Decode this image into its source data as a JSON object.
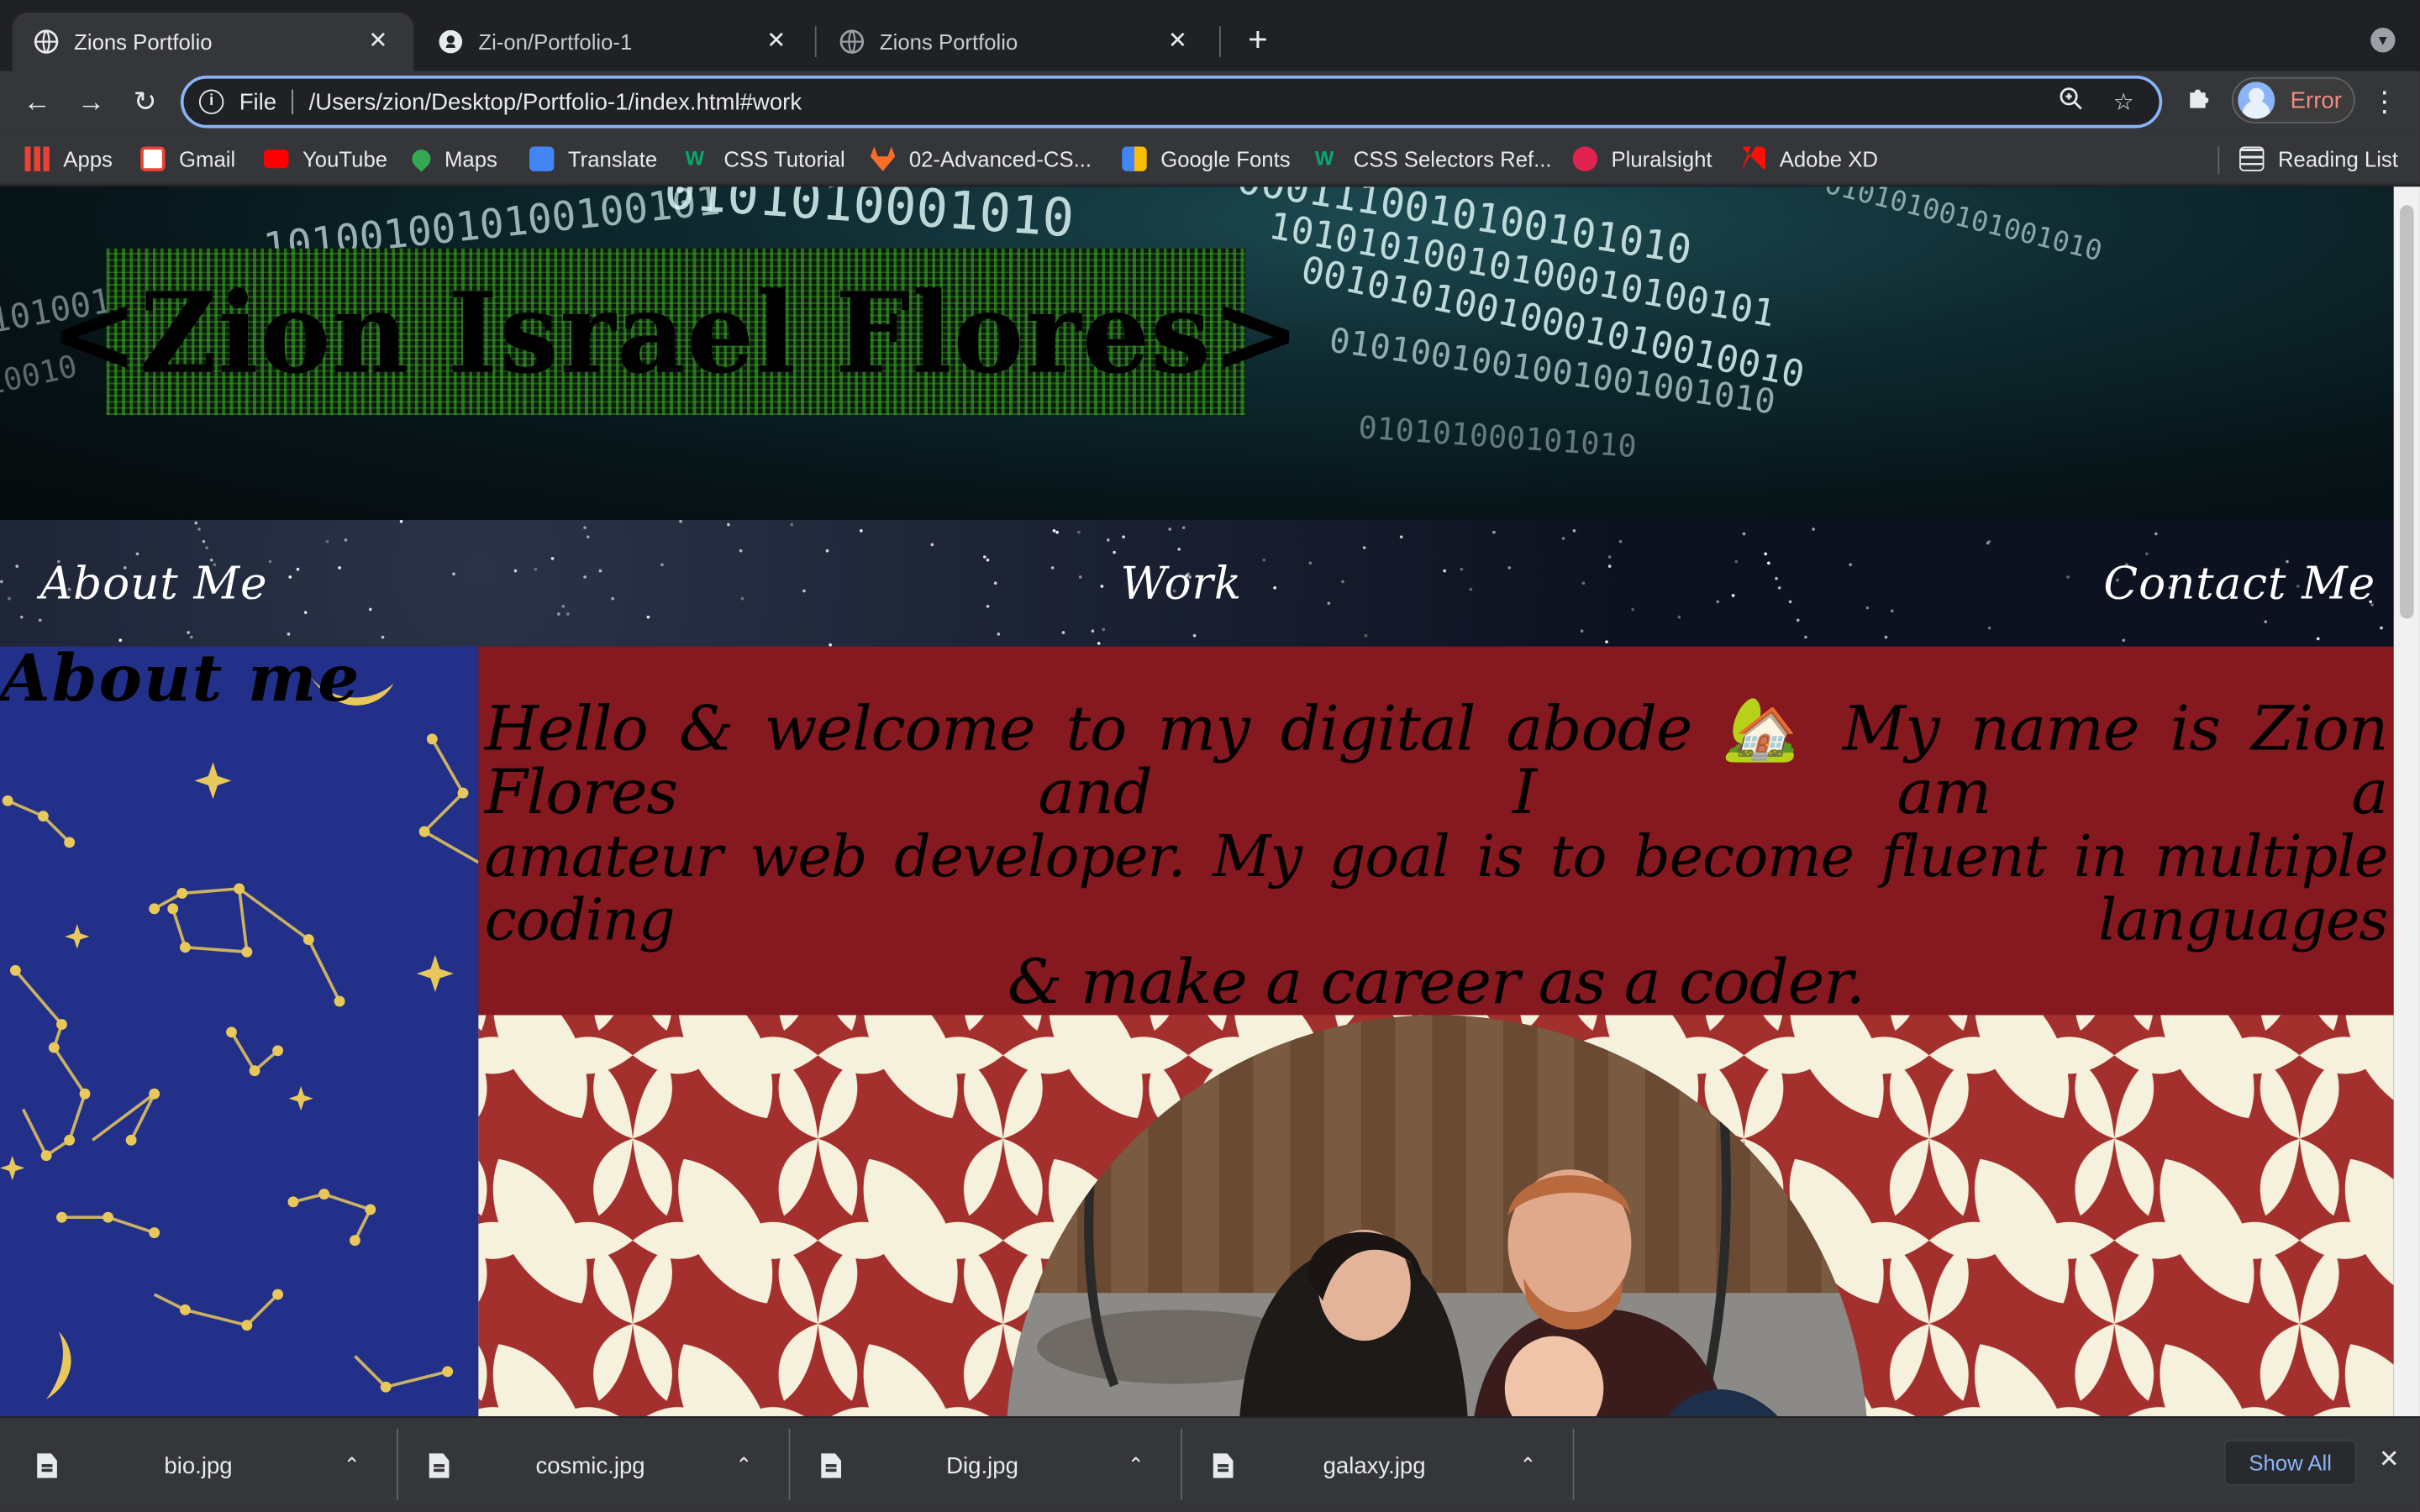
{
  "browser": {
    "tabs": [
      {
        "title": "Zions Portfolio",
        "active": true,
        "icon": "globe-icon"
      },
      {
        "title": "Zi-on/Portfolio-1",
        "active": false,
        "icon": "github-icon"
      },
      {
        "title": "Zions Portfolio",
        "active": false,
        "icon": "globe-icon"
      }
    ],
    "new_tab_label": "+",
    "address": {
      "scheme": "File",
      "url": "/Users/zion/Desktop/Portfolio-1/index.html#work"
    },
    "profile_status": "Error",
    "bookmarks": [
      {
        "label": "Apps",
        "icon": "apps-grid-icon",
        "color": "#4285f4"
      },
      {
        "label": "Gmail",
        "icon": "gmail-icon",
        "color": "#ea4335"
      },
      {
        "label": "YouTube",
        "icon": "youtube-icon",
        "color": "#ff0000"
      },
      {
        "label": "Maps",
        "icon": "maps-icon",
        "color": "#34a853"
      },
      {
        "label": "Translate",
        "icon": "translate-icon",
        "color": "#4285f4"
      },
      {
        "label": "CSS Tutorial",
        "icon": "w3schools-icon",
        "color": "#04aa6d"
      },
      {
        "label": "02-Advanced-CS...",
        "icon": "gitlab-icon",
        "color": "#fc6d26"
      },
      {
        "label": "Google Fonts",
        "icon": "google-fonts-icon",
        "color": "#4285f4"
      },
      {
        "label": "CSS Selectors Ref...",
        "icon": "w3schools-icon",
        "color": "#04aa6d"
      },
      {
        "label": "Pluralsight",
        "icon": "pluralsight-icon",
        "color": "#f15b2a"
      },
      {
        "label": "Adobe XD",
        "icon": "adobe-icon",
        "color": "#fa0f00"
      }
    ],
    "reading_list": "Reading List"
  },
  "page": {
    "hero_title": "<Zion Israel Flores>",
    "nav": {
      "about": "About Me",
      "work": "Work",
      "contact": "Contact Me"
    },
    "about_heading": "About me",
    "welcome_text_line1": "Hello & welcome to my digital abode 🏡 My name is Zion Flores and I am a",
    "welcome_text_line2": "amateur web developer. My goal is to become fluent in multiple coding languages",
    "welcome_text_line3": "& make a career as a coder.",
    "colors": {
      "about_bg": "#22308a",
      "welcome_bg": "#861820",
      "pattern_bg": "#f6f1dc",
      "pattern_accent": "#a3302d"
    }
  },
  "downloads": {
    "files": [
      "bio.jpg",
      "cosmic.jpg",
      "Dig.jpg",
      "galaxy.jpg"
    ],
    "show_all": "Show All"
  }
}
